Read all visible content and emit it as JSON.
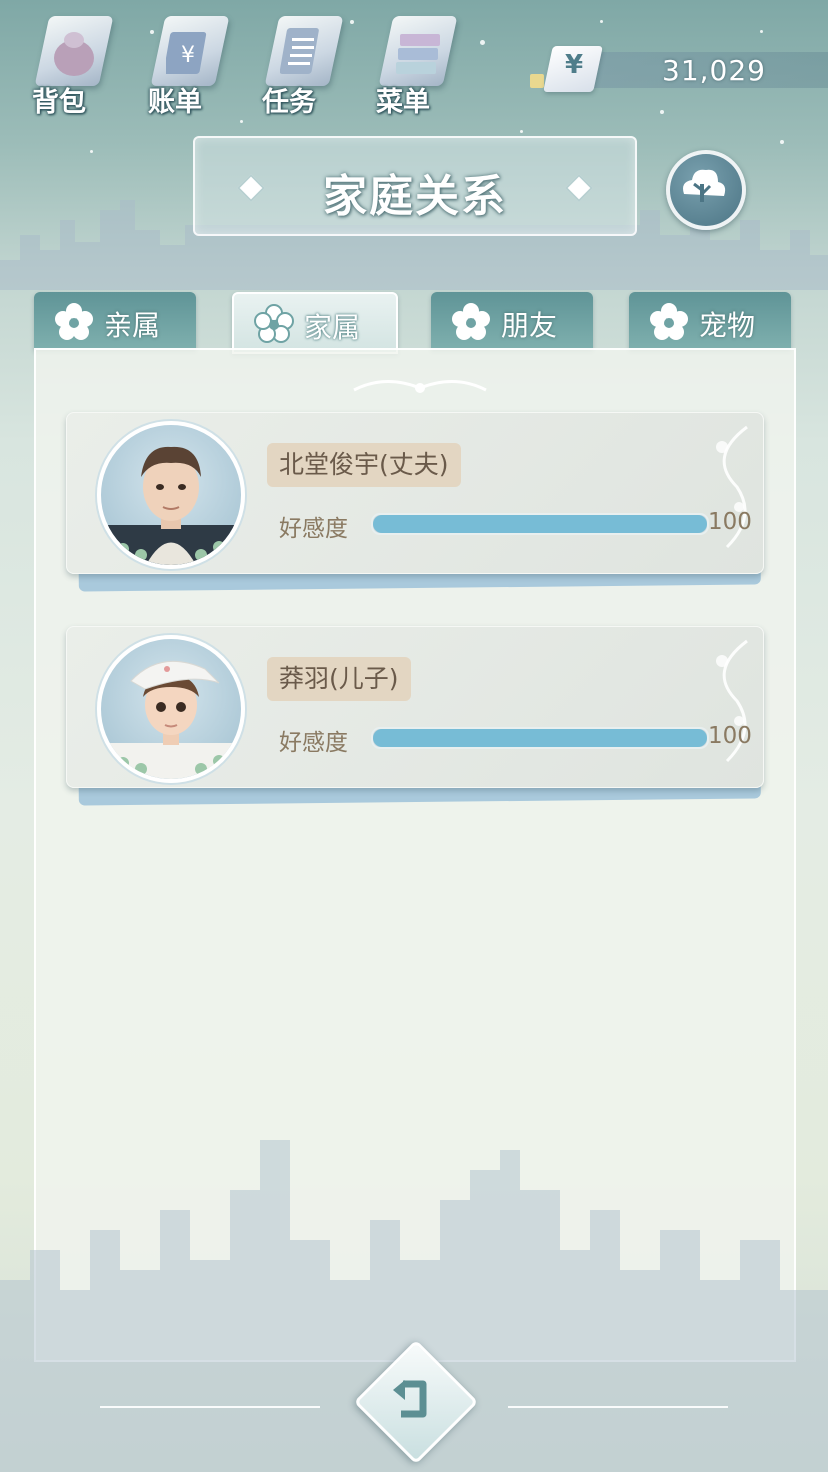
{
  "toolbar": {
    "items": [
      {
        "label": "背包",
        "icon": "backpack-icon"
      },
      {
        "label": "账单",
        "icon": "bill-icon"
      },
      {
        "label": "任务",
        "icon": "task-icon"
      },
      {
        "label": "菜单",
        "icon": "menu-icon"
      }
    ]
  },
  "currency": {
    "symbol": "¥",
    "amount": "31,029"
  },
  "header": {
    "title": "家庭关系",
    "cloud_icon": "cloud-tree-icon"
  },
  "tabs": [
    {
      "label": "亲属",
      "active": false
    },
    {
      "label": "家属",
      "active": true
    },
    {
      "label": "朋友",
      "active": false
    },
    {
      "label": "宠物",
      "active": false
    }
  ],
  "relations": [
    {
      "name": "北堂俊宇(丈夫)",
      "affection_label": "好感度",
      "affection_value": "100",
      "affection_fraction": 1.0,
      "avatar": "husband-avatar"
    },
    {
      "name": "莽羽(儿子)",
      "affection_label": "好感度",
      "affection_value": "100",
      "affection_fraction": 1.0,
      "avatar": "son-avatar"
    }
  ],
  "footer": {
    "back_icon": "return-arrow-icon"
  },
  "colors": {
    "affection_bar": "#77bcd6",
    "tab_inactive": "#6fa3a4",
    "name_tag": "#e3d6c2"
  }
}
